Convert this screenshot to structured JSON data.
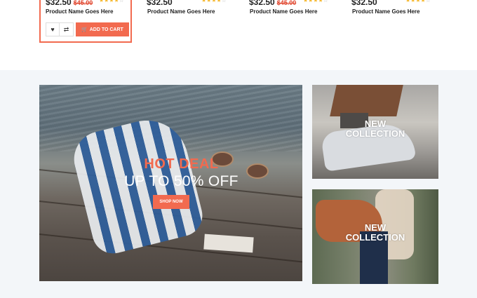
{
  "products": [
    {
      "price": "$32.50",
      "old_price": "$45.00",
      "rating": 4,
      "name": "Product Name Goes Here",
      "add_to_cart": "ADD TO CART"
    },
    {
      "price": "$32.50",
      "old_price": "",
      "rating": 4,
      "name": "Product Name Goes Here"
    },
    {
      "price": "$32.50",
      "old_price": "$45.00",
      "rating": 4,
      "name": "Product Name Goes Here"
    },
    {
      "price": "$32.50",
      "old_price": "",
      "rating": 4,
      "name": "Product Name Goes Here"
    }
  ],
  "hero": {
    "headline": "HOT DEAL",
    "subline": "UP TO 50% OFF",
    "button": "SHOP NOW"
  },
  "side_banners": [
    {
      "line1": "NEW",
      "line2": "COLLECTION"
    },
    {
      "line1": "NEW",
      "line2": "COLLECTION"
    }
  ],
  "icons": {
    "wishlist": "heart-icon",
    "compare": "compare-icon",
    "cart": "cart-icon",
    "star": "star-icon"
  },
  "colors": {
    "accent": "#f26a4f",
    "star": "#f5b72b",
    "section_bg": "#f3f6f9"
  }
}
